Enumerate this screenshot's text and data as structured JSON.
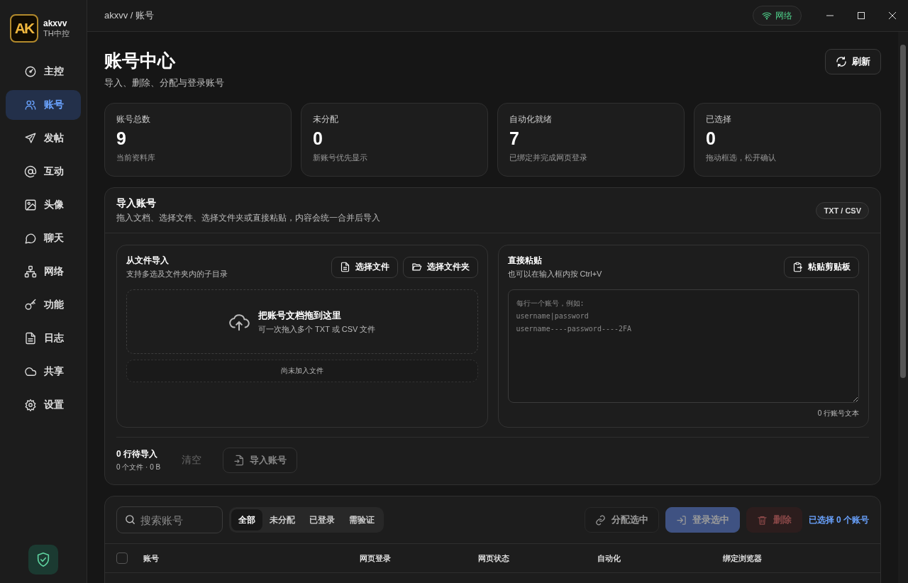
{
  "app": {
    "logo": "AK",
    "name": "akxvv",
    "subtitle": "TH中控"
  },
  "sidebar": {
    "items": [
      {
        "label": "主控",
        "selected": false
      },
      {
        "label": "账号",
        "selected": true
      },
      {
        "label": "发帖",
        "selected": false
      },
      {
        "label": "互动",
        "selected": false
      },
      {
        "label": "头像",
        "selected": false
      },
      {
        "label": "聊天",
        "selected": false
      },
      {
        "label": "网络",
        "selected": false
      },
      {
        "label": "功能",
        "selected": false
      },
      {
        "label": "日志",
        "selected": false
      },
      {
        "label": "共享",
        "selected": false
      },
      {
        "label": "设置",
        "selected": false
      }
    ]
  },
  "breadcrumb": "akxvv / 账号",
  "network_button": "网络",
  "page": {
    "title": "账号中心",
    "subtitle": "导入、删除、分配与登录账号",
    "refresh_button": "刷新"
  },
  "stats": [
    {
      "label": "账号总数",
      "value": "9",
      "note": "当前资料库"
    },
    {
      "label": "未分配",
      "value": "0",
      "note": "新账号优先显示"
    },
    {
      "label": "自动化就绪",
      "value": "7",
      "note": "已绑定并完成网页登录"
    },
    {
      "label": "已选择",
      "value": "0",
      "note": "拖动框选，松开确认"
    }
  ],
  "import": {
    "title": "导入账号",
    "subtitle": "拖入文档、选择文件、选择文件夹或直接粘贴，内容会统一合并后导入",
    "format_badge": "TXT / CSV",
    "file_panel": {
      "title": "从文件导入",
      "subtitle": "支持多选及文件夹内的子目录",
      "choose_file_button": "选择文件",
      "choose_folder_button": "选择文件夹",
      "drop_title": "把账号文档拖到这里",
      "drop_hint": "可一次拖入多个 TXT 或 CSV 文件",
      "file_list_empty": "尚未加入文件"
    },
    "paste_panel": {
      "title": "直接粘贴",
      "subtitle": "也可以在输入框内按 Ctrl+V",
      "paste_button": "粘贴剪贴板",
      "placeholder": "每行一个账号，例如:\nusername|password\nusername----password----2FA",
      "line_count": "0 行账号文本"
    },
    "summary": {
      "pending": "0 行待导入",
      "files": "0 个文件 · 0 B"
    },
    "clear_button": {
      "label": "清空",
      "disabled": true
    },
    "import_button": {
      "label": "导入账号",
      "disabled": true
    }
  },
  "accounts": {
    "search_placeholder": "搜索账号",
    "filters": [
      {
        "label": "全部",
        "selected": true
      },
      {
        "label": "未分配",
        "selected": false
      },
      {
        "label": "已登录",
        "selected": false
      },
      {
        "label": "需验证",
        "selected": false
      }
    ],
    "actions": [
      {
        "kind": "assign",
        "label": "分配选中",
        "disabled": true
      },
      {
        "kind": "login",
        "label": "登录选中",
        "disabled": true
      },
      {
        "kind": "delete",
        "label": "删除",
        "disabled": true
      }
    ],
    "selection": "已选择 0 个账号",
    "table": {
      "select_all_checked": false,
      "columns": [
        "账号",
        "网页登录",
        "网页状态",
        "自动化",
        "绑定浏览器"
      ]
    }
  }
}
